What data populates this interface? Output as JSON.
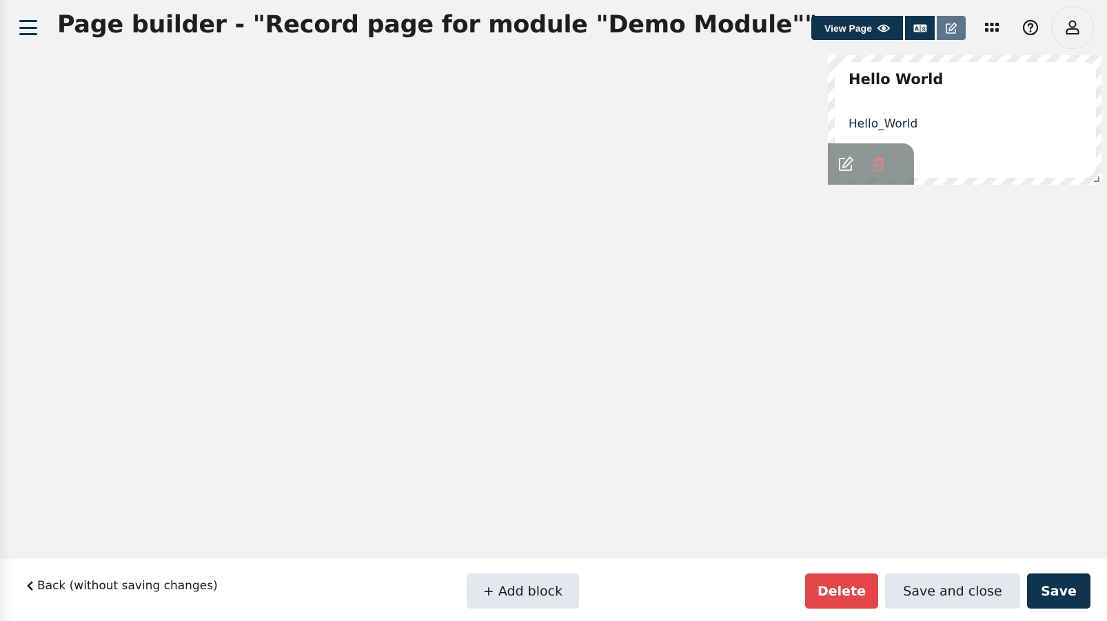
{
  "header": {
    "title": "Page builder - \"Record page for module \"Demo Module\"\"",
    "view_page_label": "View Page",
    "icons": {
      "menu": "hamburger-icon",
      "view": "eye-icon",
      "translate": "translate-icon",
      "edit": "edit-icon",
      "apps": "grid-icon",
      "help": "help-icon",
      "user": "user-icon"
    }
  },
  "canvas": {
    "blocks": [
      {
        "title": "Hello World",
        "value": "Hello_World",
        "toolbar": [
          "edit-icon",
          "trash-icon"
        ]
      }
    ]
  },
  "footer": {
    "back_label": "Back (without saving changes)",
    "add_block_label": "+ Add block",
    "delete_label": "Delete",
    "save_close_label": "Save and close",
    "save_label": "Save"
  },
  "colors": {
    "primary": "#0e3450",
    "danger": "#e3474a",
    "secondary": "#e3e7ee",
    "edit_active": "#5d7587"
  }
}
